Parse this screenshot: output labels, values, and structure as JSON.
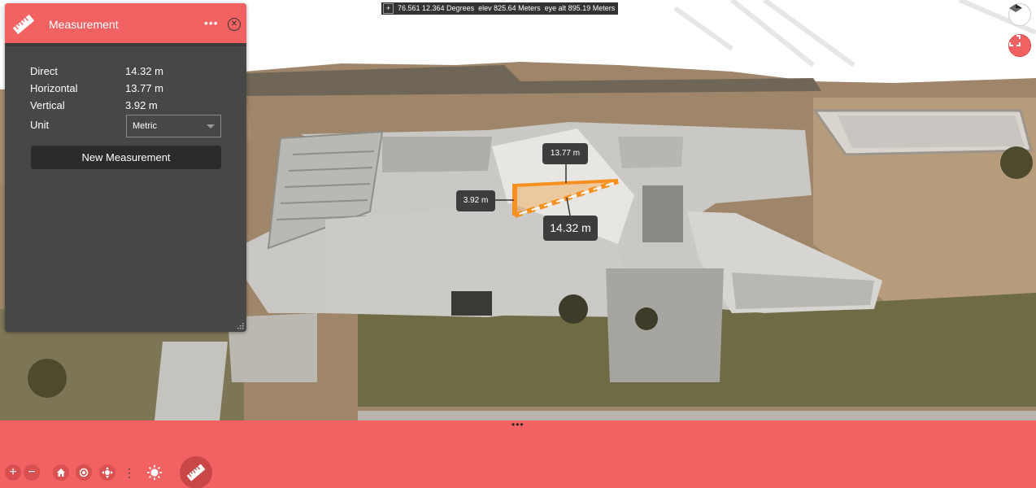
{
  "coordinates": {
    "position": "76.561 12.364 Degrees",
    "elevation": "elev 825.64 Meters",
    "eye_altitude": "eye alt 895.19 Meters"
  },
  "panel": {
    "title": "Measurement",
    "more_label": "•••",
    "close_label": "✕",
    "rows": {
      "direct": {
        "label": "Direct",
        "value": "14.32 m"
      },
      "horizontal": {
        "label": "Horizontal",
        "value": "13.77 m"
      },
      "vertical": {
        "label": "Vertical",
        "value": "3.92 m"
      },
      "unit": {
        "label": "Unit"
      }
    },
    "unit_selected": "Metric",
    "new_measurement_label": "New Measurement"
  },
  "scene_labels": {
    "horizontal": "13.77 m",
    "vertical": "3.92 m",
    "direct": "14.32 m"
  },
  "bottom_bar": {
    "handle": "•••",
    "zoom_in": "+",
    "zoom_out": "−",
    "more_tools": "⋮"
  },
  "colors": {
    "accent": "#f26262",
    "panel_bg": "#474747",
    "measure_line": "#f7901e"
  },
  "icons": [
    "ruler-icon",
    "more-icon",
    "close-icon",
    "compass-icon",
    "fullscreen-icon",
    "home-icon",
    "locate-icon",
    "navigation-icon",
    "sun-icon"
  ]
}
